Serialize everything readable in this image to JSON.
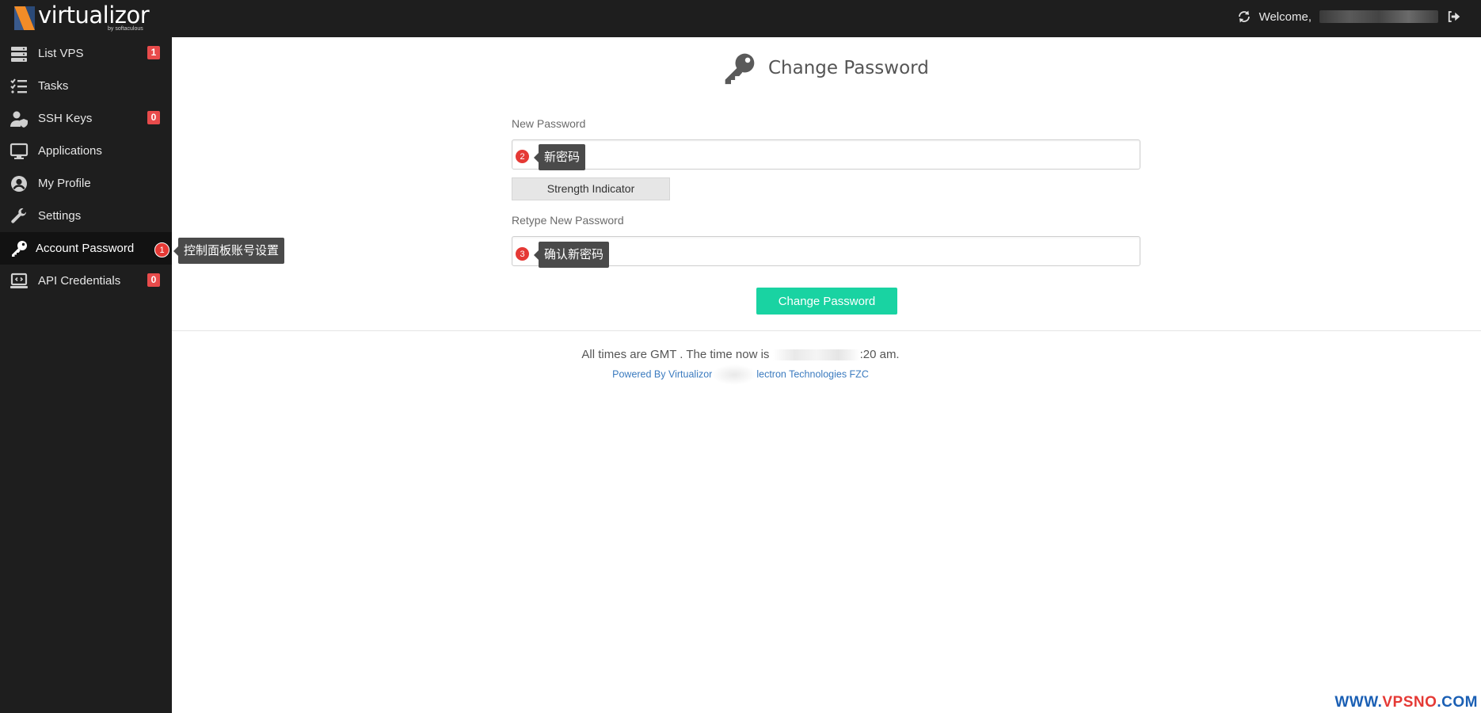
{
  "brand": {
    "name": "virtualizor",
    "sub": "by softaculous"
  },
  "header": {
    "welcome": "Welcome,"
  },
  "sidebar": {
    "items": [
      {
        "label": "List VPS",
        "badge": "1"
      },
      {
        "label": "Tasks"
      },
      {
        "label": "SSH Keys",
        "badge": "0"
      },
      {
        "label": "Applications"
      },
      {
        "label": "My Profile"
      },
      {
        "label": "Settings"
      },
      {
        "label": "Account Password"
      },
      {
        "label": "API Credentials",
        "badge": "0"
      }
    ]
  },
  "callouts": [
    {
      "num": "1",
      "text": "控制面板账号设置"
    },
    {
      "num": "2",
      "text": "新密码"
    },
    {
      "num": "3",
      "text": "确认新密码"
    }
  ],
  "main": {
    "title": "Change Password",
    "new_password_label": "New Password",
    "strength_label": "Strength Indicator",
    "retype_label": "Retype New Password",
    "submit_label": "Change Password"
  },
  "footer": {
    "time_prefix": "All times are GMT . The time now is",
    "time_suffix": ":20 am.",
    "credit_prefix": "Powered By Virtualizor",
    "credit_suffix": "lectron Technologies FZC"
  },
  "watermark": {
    "part1": "WWW.",
    "part2": "VPSNO",
    "part3": ".COM"
  },
  "colors": {
    "sidebar_bg": "#1e1e1e",
    "accent_button": "#19d3a2",
    "badge": "#e84b4b",
    "callout_dot": "#e53935"
  }
}
